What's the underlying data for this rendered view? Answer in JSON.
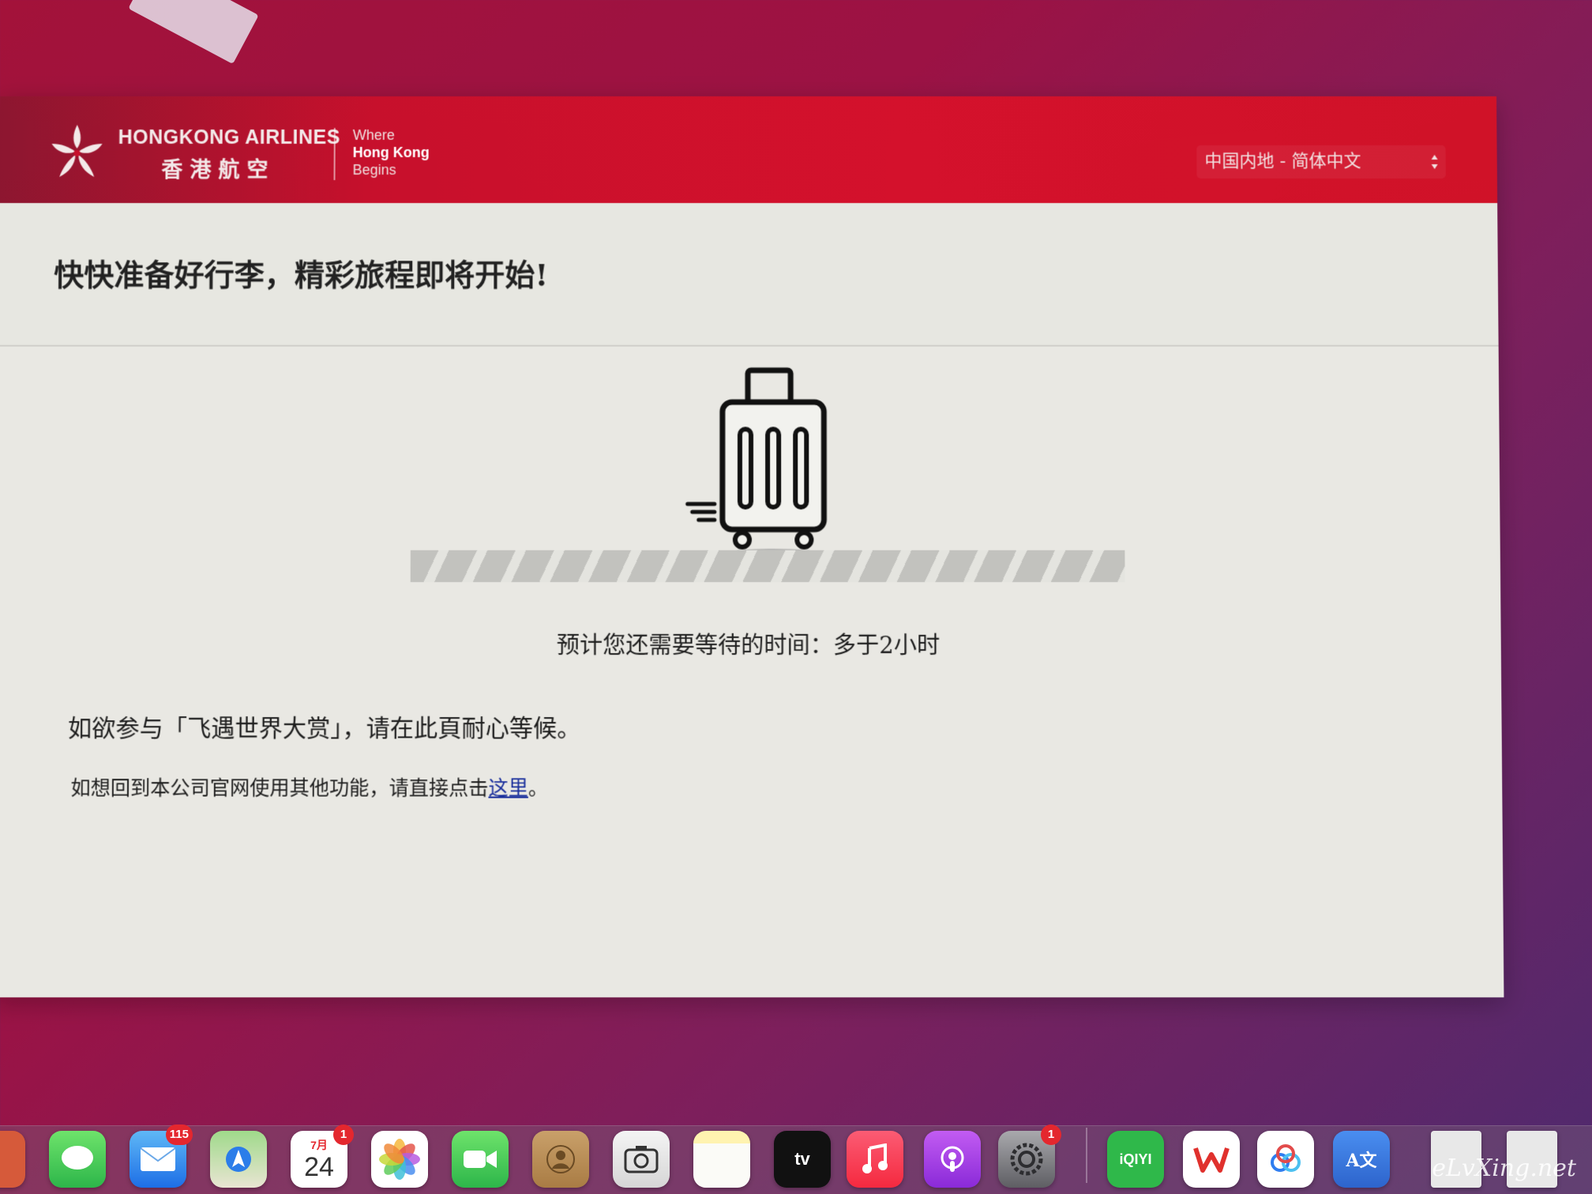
{
  "header": {
    "brand_en": "HONGKONG AIRLINES",
    "brand_zh": "香港航空",
    "tagline_1": "Where",
    "tagline_2": "Hong Kong",
    "tagline_3": "Begins",
    "language_selected": "中国内地 - 简体中文"
  },
  "main": {
    "headline": "快快准备好行李，精彩旅程即将开始!",
    "wait_label": "预计您还需要等待的时间：",
    "wait_value": "多于2小时",
    "award_text": "如欲参与「飞遇世界大赏」，请在此頁耐心等候。",
    "return_prefix": "如想回到本公司官网使用其他功能，请直接点击",
    "return_link": "这里",
    "return_suffix": "。",
    "progress_fraction": 1.0
  },
  "dock": {
    "mail_badge": "115",
    "calendar_month": "7月",
    "calendar_day": "24",
    "calendar_badge": "1",
    "tv_label": "tv",
    "settings_badge": "1",
    "iqiyi_label": "iQIYI",
    "translate_label": "A文"
  },
  "watermark": "eLvXing.net",
  "colors": {
    "brand_red": "#d4112c",
    "link_blue": "#1a2f9c"
  }
}
